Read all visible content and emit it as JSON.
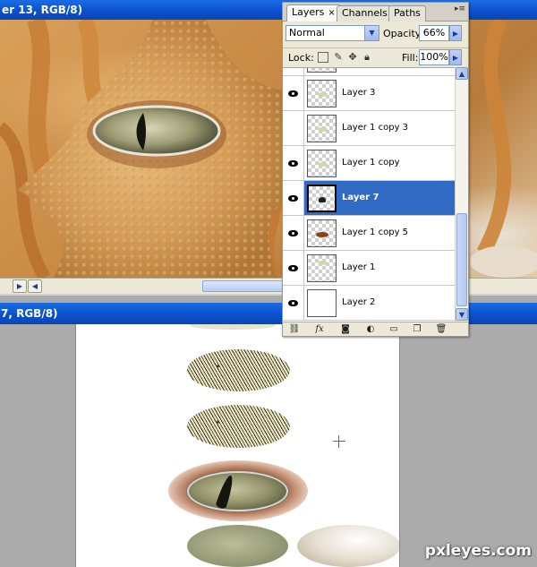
{
  "doc1": {
    "title": "er 13, RGB/8)"
  },
  "doc2": {
    "title": "7, RGB/8)"
  },
  "palette": {
    "tabs": [
      {
        "label": "Layers",
        "close": "×"
      },
      {
        "label": "Channels"
      },
      {
        "label": "Paths"
      }
    ],
    "blend_mode": "Normal",
    "opacity_label": "Opacity:",
    "opacity_value": "66%",
    "lock_label": "Lock:",
    "fill_label": "Fill:",
    "fill_value": "100%",
    "layers": [
      {
        "name": "Layer 3",
        "visible": true,
        "selected": false,
        "mark_color": "#d8d6a8"
      },
      {
        "name": "Layer 1 copy 3",
        "visible": false,
        "selected": false,
        "mark_color": "#d8d6a8"
      },
      {
        "name": "Layer 1 copy",
        "visible": true,
        "selected": false,
        "mark_color": "#d8d6a8"
      },
      {
        "name": "Layer 7",
        "visible": true,
        "selected": true,
        "mark_color": "#222222"
      },
      {
        "name": "Layer 1 copy 5",
        "visible": true,
        "selected": false,
        "mark_color": "#8a3f16"
      },
      {
        "name": "Layer 1",
        "visible": true,
        "selected": false,
        "mark_color": "#d8d6a8"
      },
      {
        "name": "Layer 2",
        "visible": true,
        "selected": false,
        "mark_color": ""
      }
    ],
    "footer_icons": [
      "link-icon",
      "fx-icon",
      "mask-icon",
      "adjustment-icon",
      "group-icon",
      "new-layer-icon",
      "trash-icon"
    ]
  },
  "watermark": "pxleyes.com",
  "colors": {
    "selection": "#316ac5",
    "titlebar": "#0a4fc9",
    "palette_bg": "#ece9d8"
  }
}
